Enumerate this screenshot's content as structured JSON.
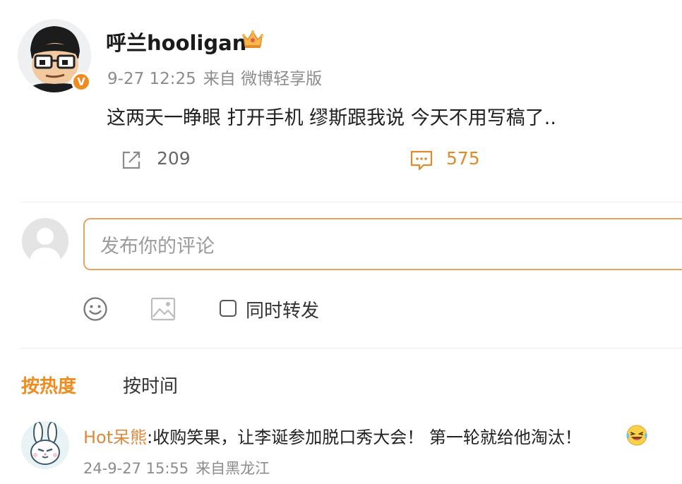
{
  "post": {
    "username": "呼兰hooligan",
    "time": "9-27 12:25",
    "source": "来自 微博轻享版",
    "text": "这两天一睁眼 打开手机 缪斯跟我说 今天不用写稿了..",
    "verified_mark": "V",
    "repost_count": "209",
    "comment_count": "575"
  },
  "composer": {
    "placeholder": "发布你的评论",
    "repost_label": "同时转发"
  },
  "sort_tabs": {
    "hot": "按热度",
    "time": "按时间"
  },
  "top_comment": {
    "user": "Hot呆熊",
    "separator": ":",
    "text": "收购笑果，让李诞参加脱口秀大会！ 第一轮就给他淘汰！",
    "time": "24-9-27 15:55",
    "source": "来自黑龙江"
  },
  "icons": {
    "crown": "crown-icon",
    "repost": "share-icon",
    "comment": "comment-icon",
    "emoji": "smiley-icon",
    "image": "image-icon",
    "laugh": "laughing-crying-emoji-icon"
  },
  "colors": {
    "accent": "#f08b1f",
    "input_border": "#e8a45f",
    "meta_text": "#8c8c8c",
    "commenter_name": "#e0883a"
  }
}
